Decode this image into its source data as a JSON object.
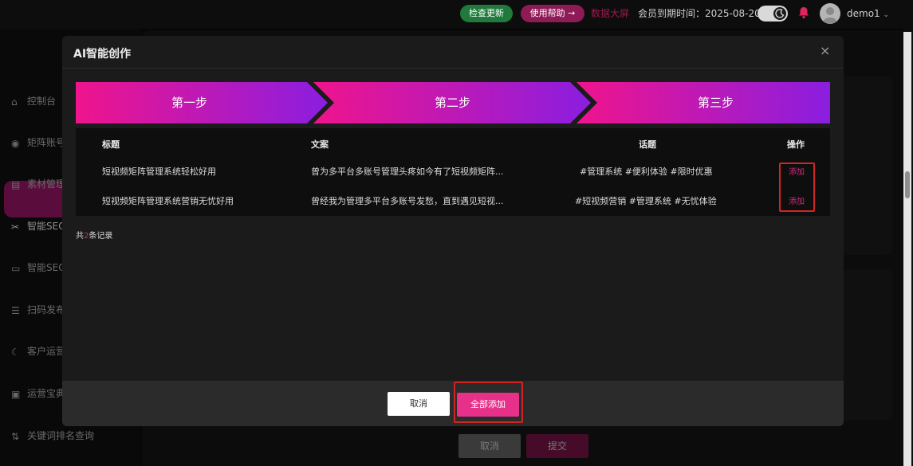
{
  "topbar": {
    "check_update": "检查更新",
    "help": "使用帮助 →",
    "data_screen": "数据大屏",
    "member_label": "会员到期时间：",
    "member_date": "2025-08-20",
    "username": "demo1",
    "username_caret": "⌄"
  },
  "sidebar": {
    "items": [
      {
        "label": "控制台",
        "icon": "home-icon"
      },
      {
        "label": "矩阵账号",
        "icon": "account-icon"
      },
      {
        "label": "素材管理",
        "icon": "folder-icon"
      },
      {
        "label": "智能SEO",
        "icon": "magic-icon"
      },
      {
        "label": "智能SEO",
        "icon": "video-icon"
      },
      {
        "label": "扫码发布",
        "icon": "scan-icon"
      },
      {
        "label": "客户运营",
        "icon": "customer-icon"
      },
      {
        "label": "运营宝典",
        "icon": "book-icon"
      },
      {
        "label": "关键词排名查询",
        "icon": "sort-icon"
      }
    ]
  },
  "background": {
    "cancel": "取消",
    "submit": "提交"
  },
  "modal": {
    "title": "AI智能创作",
    "close": "×",
    "steps": [
      "第一步",
      "第二步",
      "第三步"
    ],
    "table": {
      "headers": [
        "标题",
        "文案",
        "话题",
        "操作"
      ],
      "rows": [
        {
          "title": "短视频矩阵管理系统轻松好用",
          "copy": "曾为多平台多账号管理头疼如今有了短视频矩阵...",
          "topic": "#管理系统 #便利体验 #限时优惠",
          "action": "添加"
        },
        {
          "title": "短视频矩阵管理系统营销无忧好用",
          "copy": "曾经我为管理多平台多账号发愁，直到遇见短视...",
          "topic": "#短视频营销 #管理系统 #无忧体验",
          "action": "添加"
        }
      ]
    },
    "records": {
      "prefix": "共",
      "count": "2",
      "suffix": "条记录"
    },
    "footer": {
      "cancel": "取消",
      "add_all": "全部添加"
    }
  },
  "colors": {
    "accent": "#e6308a",
    "step_start": "#f0148c",
    "step_end": "#8a1ee0",
    "highlight_box": "#d32424"
  }
}
